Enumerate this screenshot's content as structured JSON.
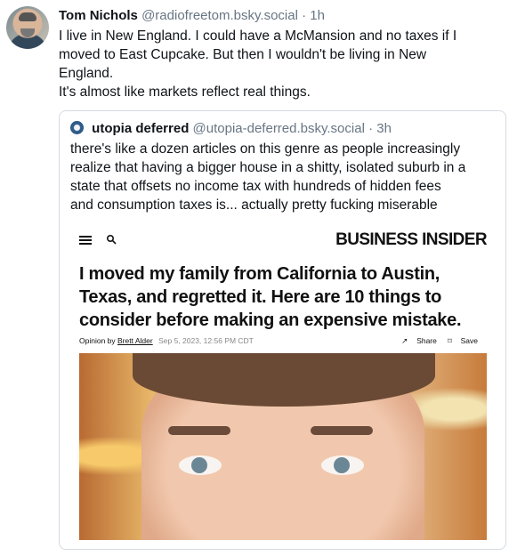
{
  "post": {
    "author_name": "Tom Nichols",
    "author_handle": "@radiofreetom.bsky.social",
    "separator": "·",
    "time": "1h",
    "body_lines": [
      "I live in New England. I could have a McMansion and no taxes if I",
      "moved to East Cupcake. But then I wouldn't be living in New",
      "England.",
      "It's almost like markets reflect real things."
    ]
  },
  "quote": {
    "author_name": "utopia deferred",
    "author_handle": "@utopia-deferred.bsky.social",
    "separator": "·",
    "time": "3h",
    "body_lines": [
      "there's like a dozen articles on this genre as people increasingly",
      "realize that having a bigger house in a shitty, isolated suburb in a",
      "state that offsets no income tax with hundreds of hidden fees",
      "and consumption taxes is...  actually pretty fucking miserable"
    ]
  },
  "embed": {
    "brand": "BUSINESS INSIDER",
    "headline_lines": [
      "I moved my family from California to Austin,",
      "Texas, and regretted it. Here are 10 things to",
      "consider before making an expensive mistake."
    ],
    "byline_prefix": "Opinion by",
    "byline_author": "Brett Alder",
    "byline_date": "Sep 5, 2023, 12:56 PM CDT",
    "share_label": "Share",
    "save_label": "Save",
    "icons": {
      "menu": "hamburger-menu-icon",
      "search": "search-icon",
      "share": "share-arrow-icon",
      "save": "bookmark-icon"
    }
  }
}
